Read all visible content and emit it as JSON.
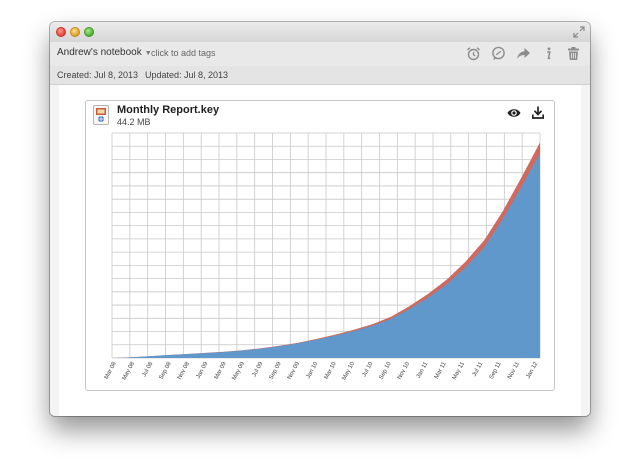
{
  "toolbar": {
    "notebook": "Andrew's notebook",
    "tags_placeholder": "click to add tags"
  },
  "meta": {
    "created": "Created: Jul 8, 2013",
    "updated": "Updated: Jul 8, 2013"
  },
  "attachment": {
    "name": "Monthly Report.key",
    "size": "44.2 MB"
  },
  "colors": {
    "area_main": "#6198cc",
    "area_top": "#cf6a60",
    "grid": "#c8c8c8"
  },
  "chart_data": {
    "type": "area",
    "x_tick_labels": [
      "Mar 08",
      "May 08",
      "Jul 08",
      "Sep 08",
      "Nov 08",
      "Jan 09",
      "Mar 09",
      "May 09",
      "Jul 09",
      "Sep 09",
      "Nov 09",
      "Jan 10",
      "Mar 10",
      "May 10",
      "Jul 10",
      "Sep 10",
      "Nov 10",
      "Jan 11",
      "Mar 11",
      "May 11",
      "Jul 11",
      "Sep 11",
      "Nov 11",
      "Jan 12"
    ],
    "grid": true,
    "series": [
      {
        "values": [
          0.0,
          0.6,
          1.8,
          3.1,
          4.2,
          5.2,
          6.4,
          8.0,
          10.0,
          12.6,
          15.7,
          19.6,
          23.9,
          28.7,
          34.3,
          41.7,
          52.4,
          64.5,
          78.7,
          96.6,
          118.2,
          148.2,
          182.5,
          218.5
        ]
      },
      {
        "values": [
          0.0,
          0.1,
          0.1,
          0.1,
          0.1,
          0.2,
          0.2,
          0.2,
          0.3,
          0.4,
          0.5,
          0.8,
          1.1,
          1.5,
          1.9,
          2.3,
          3.1,
          4.0,
          5.1,
          6.2,
          7.5,
          8.5,
          10.0,
          11.5
        ]
      }
    ]
  }
}
